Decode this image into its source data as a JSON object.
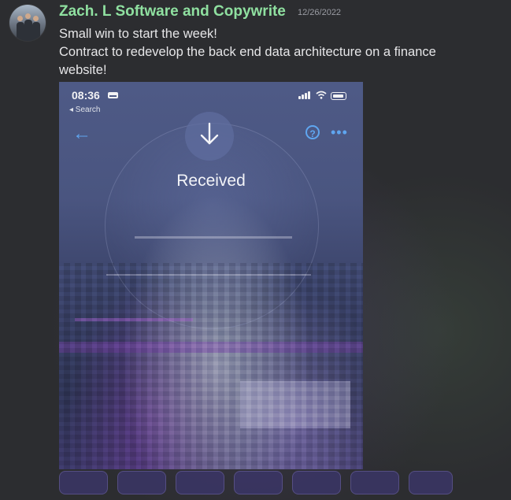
{
  "message": {
    "username": "Zach. L Software and Copywrite",
    "timestamp": "12/26/2022",
    "lines": [
      "Small win to start the week!",
      "Contract to redevelop the back end data architecture on a finance",
      "website!"
    ]
  },
  "attachment": {
    "status_bar": {
      "time": "08:36",
      "back_label": "◂ Search"
    },
    "screen_title": "Received"
  },
  "colors": {
    "username": "#8fe0a0",
    "accent_blue": "#5fa6f0",
    "background": "#2c2d30"
  }
}
